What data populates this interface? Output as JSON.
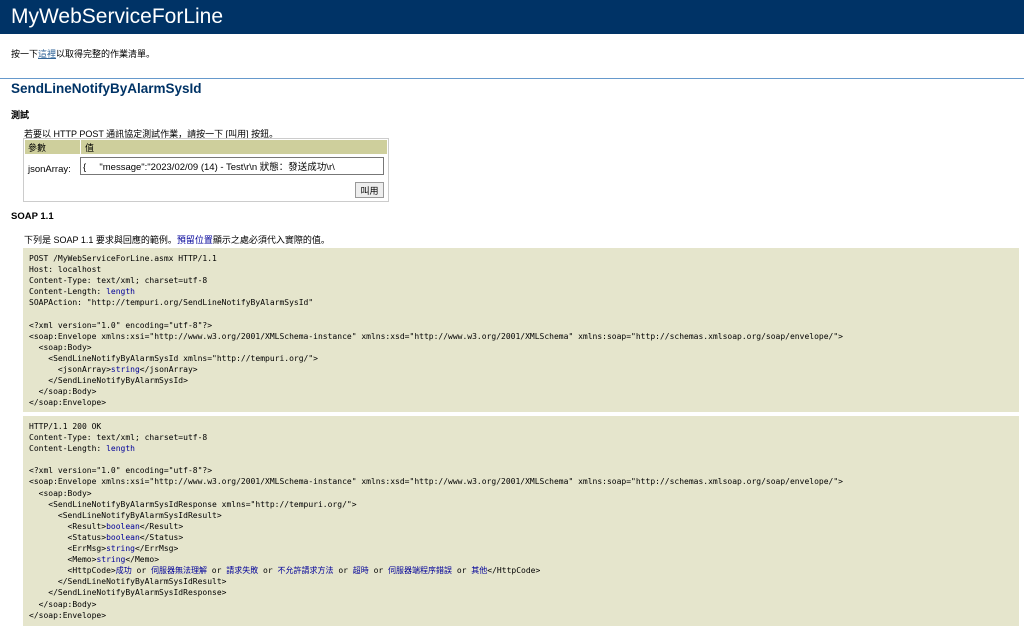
{
  "header": {
    "title": "MyWebServiceForLine"
  },
  "intro": {
    "prefix": "按一下",
    "link": "這裡",
    "suffix": "以取得完整的作業清單。"
  },
  "operation": {
    "title": "SendLineNotifyByAlarmSysId"
  },
  "test": {
    "heading": "測試",
    "description": "若要以 HTTP POST 通訊協定測試作業，請按一下 [叫用] 按鈕。",
    "col_param": "參數",
    "col_value": "值",
    "param_name": "jsonArray:",
    "param_value": "{     \"message\":\"2023/02/09 (14) - Test\\r\\n 狀態：發送成功\\r\\",
    "invoke_label": "叫用"
  },
  "soap": {
    "heading": "SOAP 1.1",
    "desc_prefix": "下列是 SOAP 1.1 要求與回應的範例。",
    "desc_placeholder": "預留位置",
    "desc_suffix": "顯示之處必須代入實際的值。",
    "request": {
      "l1": "POST /MyWebServiceForLine.asmx HTTP/1.1",
      "l2": "Host: localhost",
      "l3": "Content-Type: text/xml; charset=utf-8",
      "l4a": "Content-Length: ",
      "l4b": "length",
      "l5": "SOAPAction: \"http://tempuri.org/SendLineNotifyByAlarmSysId\"",
      "l7": "<?xml version=\"1.0\" encoding=\"utf-8\"?>",
      "l8": "<soap:Envelope xmlns:xsi=\"http://www.w3.org/2001/XMLSchema-instance\" xmlns:xsd=\"http://www.w3.org/2001/XMLSchema\" xmlns:soap=\"http://schemas.xmlsoap.org/soap/envelope/\">",
      "l9": "  <soap:Body>",
      "l10": "    <SendLineNotifyByAlarmSysId xmlns=\"http://tempuri.org/\">",
      "l11a": "      <jsonArray>",
      "l11b": "string",
      "l11c": "</jsonArray>",
      "l12": "    </SendLineNotifyByAlarmSysId>",
      "l13": "  </soap:Body>",
      "l14": "</soap:Envelope>"
    },
    "response": {
      "l1": "HTTP/1.1 200 OK",
      "l2": "Content-Type: text/xml; charset=utf-8",
      "l3a": "Content-Length: ",
      "l3b": "length",
      "l5": "<?xml version=\"1.0\" encoding=\"utf-8\"?>",
      "l6": "<soap:Envelope xmlns:xsi=\"http://www.w3.org/2001/XMLSchema-instance\" xmlns:xsd=\"http://www.w3.org/2001/XMLSchema\" xmlns:soap=\"http://schemas.xmlsoap.org/soap/envelope/\">",
      "l7": "  <soap:Body>",
      "l8": "    <SendLineNotifyByAlarmSysIdResponse xmlns=\"http://tempuri.org/\">",
      "l9": "      <SendLineNotifyByAlarmSysIdResult>",
      "result_open": "        <Result>",
      "result_val": "boolean",
      "result_close": "</Result>",
      "status_open": "        <Status>",
      "status_val": "boolean",
      "status_close": "</Status>",
      "err_open": "        <ErrMsg>",
      "err_val": "string",
      "err_close": "</ErrMsg>",
      "memo_open": "        <Memo>",
      "memo_val": "string",
      "memo_close": "</Memo>",
      "http_open": "        <HttpCode>",
      "http_v1": "成功",
      "http_v2": "伺服器無法理解",
      "http_v3": "請求失敗",
      "http_v4": "不允許請求方法",
      "http_v5": "超時",
      "http_v6": "伺服器端程序錯誤",
      "http_v7": "其他",
      "or": " or ",
      "http_close": "</HttpCode>",
      "l16": "      </SendLineNotifyByAlarmSysIdResult>",
      "l17": "    </SendLineNotifyByAlarmSysIdResponse>",
      "l18": "  </soap:Body>",
      "l19": "</soap:Envelope>"
    }
  }
}
